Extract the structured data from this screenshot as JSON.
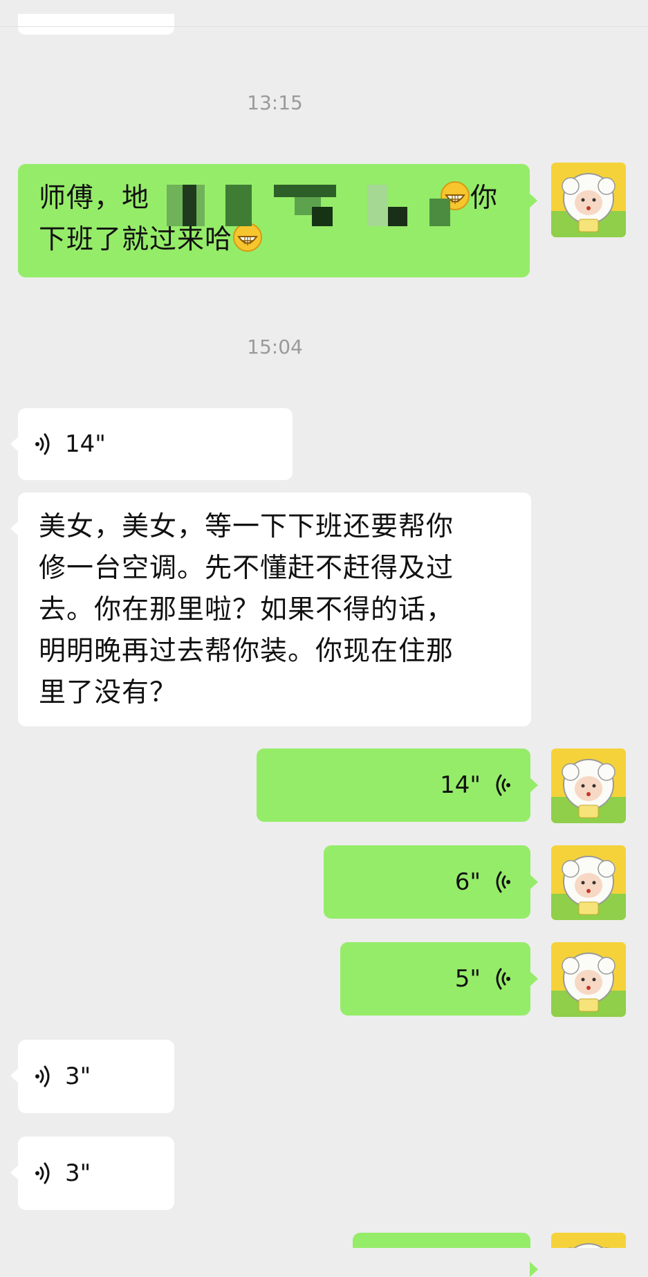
{
  "timestamps": [
    "13:15",
    "15:04"
  ],
  "messages": {
    "m1": {
      "line1_start": "师傅，地",
      "line1_end": "你",
      "line2": "下班了就过来哈"
    },
    "v1": {
      "duration": "14\""
    },
    "t1": {
      "lines": [
        "美女，美女，等一下下班还要帮你",
        "修一台空调。先不懂赶不赶得及过",
        "去。你在那里啦？如果不得的话，",
        "明明晚再过去帮你装。你现在住那",
        "里了没有？"
      ]
    },
    "v2": {
      "duration": "14\""
    },
    "v3": {
      "duration": "6\""
    },
    "v4": {
      "duration": "5\""
    },
    "v5": {
      "duration": "3\""
    },
    "v6": {
      "duration": "3\""
    }
  },
  "colors": {
    "background": "#ededed",
    "sent_bubble": "#95ec69",
    "received_bubble": "#ffffff",
    "timestamp": "#9a9a9a"
  },
  "icons": {
    "voice_received": "voice-wave-right-icon",
    "voice_sent": "voice-wave-left-icon",
    "avatar": "sheep-avatar",
    "emoji": "grin-emoji"
  }
}
